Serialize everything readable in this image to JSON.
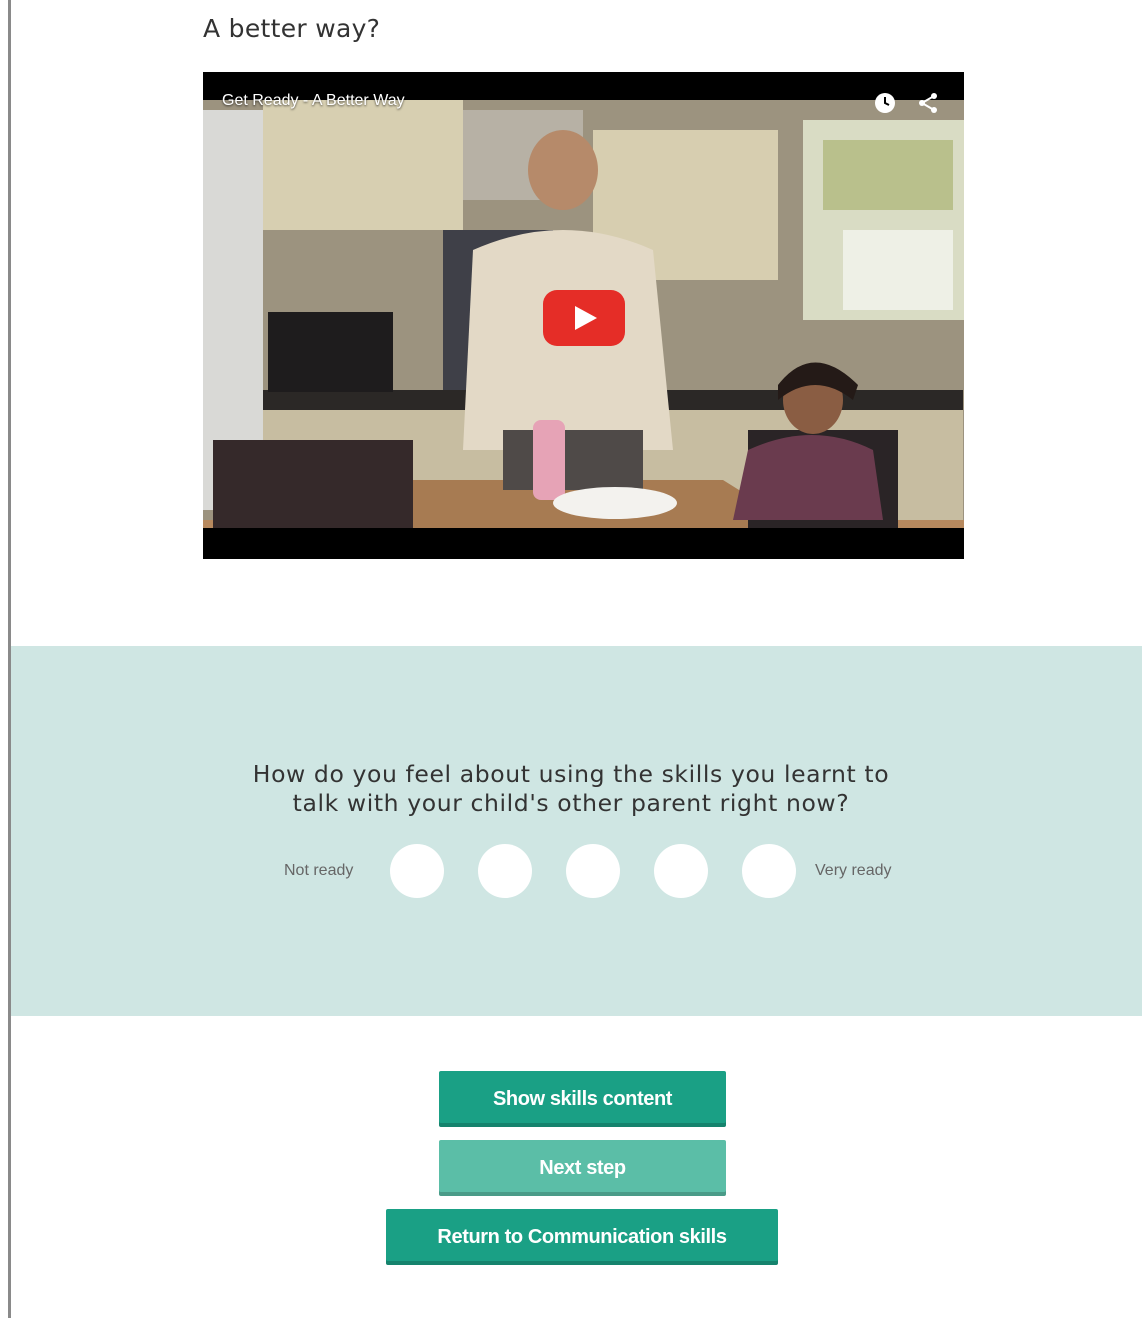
{
  "section_title": "A better way?",
  "video": {
    "title": "Get Ready - A Better Way",
    "icons": [
      "clock-icon",
      "share-icon",
      "play-icon"
    ]
  },
  "survey": {
    "question_line1": "How do you feel about using the skills you learnt to",
    "question_line2": "talk with your child's other parent right now?",
    "scale_min_label": "Not ready",
    "scale_max_label": "Very ready",
    "options": 5,
    "selected": null
  },
  "buttons": {
    "show_skills": "Show skills content",
    "next_step": "Next step",
    "return": "Return to Communication skills"
  },
  "colors": {
    "band": "#cfe6e3",
    "button_primary": "#1aa085",
    "button_light": "#5bbea7",
    "play_red": "#e52d27"
  }
}
